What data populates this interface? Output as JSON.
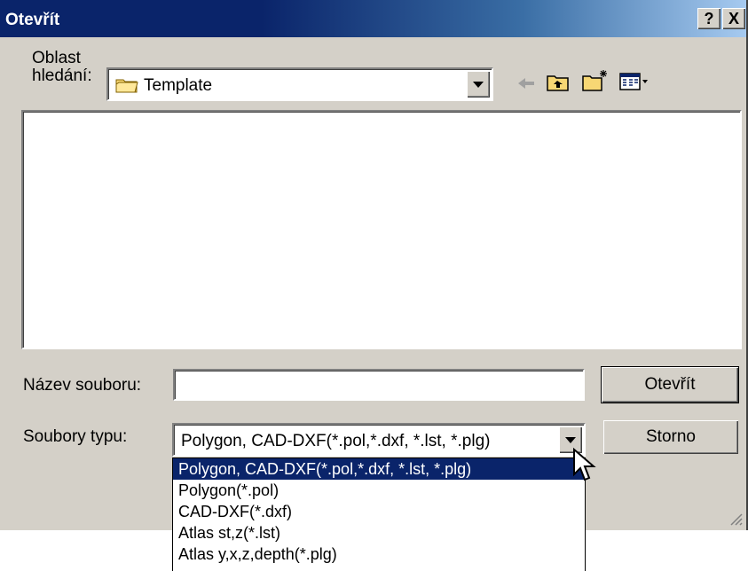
{
  "window": {
    "title": "Otevřít",
    "help_label": "?",
    "close_label": "X"
  },
  "lookin": {
    "label_line1": "Oblast",
    "label_line2": "hledání:",
    "folder": "Template"
  },
  "filename": {
    "label": "Název souboru:",
    "value": ""
  },
  "filetype": {
    "label": "Soubory typu:",
    "selected": "Polygon, CAD-DXF(*.pol,*.dxf, *.lst, *.plg)",
    "options": [
      "Polygon, CAD-DXF(*.pol,*.dxf, *.lst, *.plg)",
      "Polygon(*.pol)",
      "CAD-DXF(*.dxf)",
      "Atlas st,z(*.lst)",
      "Atlas y,x,z,depth(*.plg)"
    ],
    "highlighted_index": 0
  },
  "buttons": {
    "open": "Otevřít",
    "cancel": "Storno"
  },
  "toolbar": {
    "icons": [
      "back-arrow-icon",
      "up-folder-icon",
      "new-folder-icon",
      "view-menu-icon"
    ]
  },
  "colors": {
    "titlebar": "#0a246a",
    "face": "#d4d0c8",
    "selection": "#0a246a"
  }
}
